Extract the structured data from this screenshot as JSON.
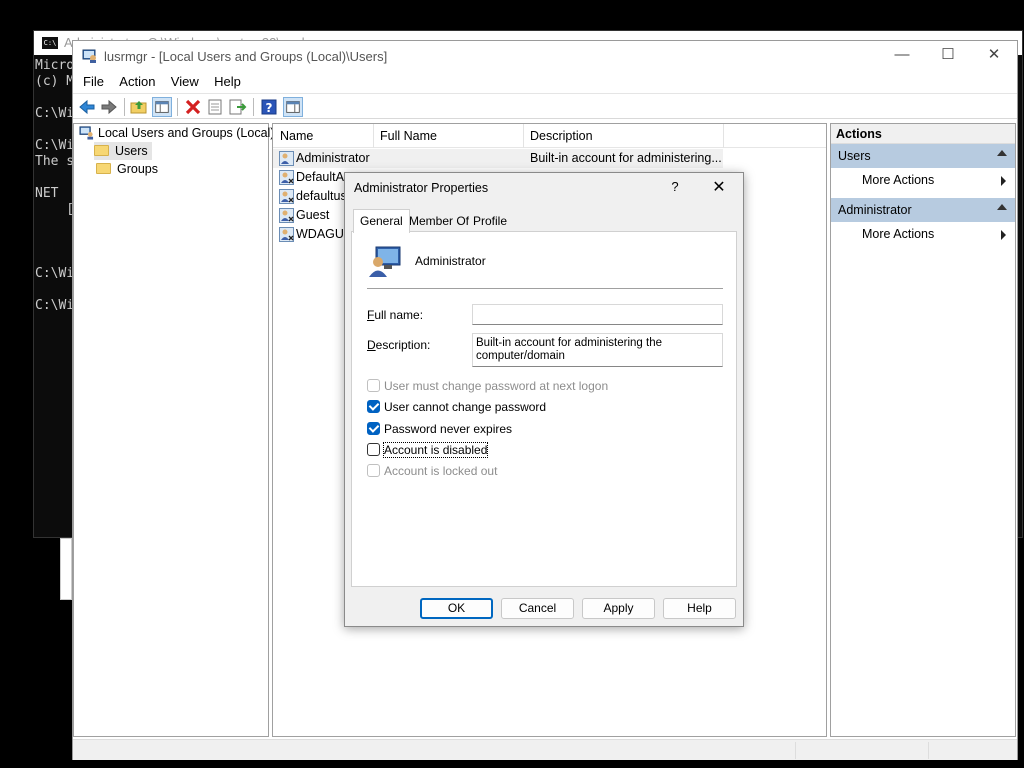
{
  "console": {
    "title": "Administrator: C:\\Windows\\system32\\cmd.exe",
    "lines": [
      "Micro",
      "(c) M",
      "",
      "C:\\Wi",
      "",
      "C:\\Wi",
      "The s",
      "",
      "NET",
      "    [",
      "",
      "",
      "",
      "C:\\Wi",
      "",
      "C:\\Wi"
    ]
  },
  "window": {
    "title": "lusrmgr - [Local Users and Groups (Local)\\Users]",
    "minimize": "—",
    "maximize": "☐",
    "close": "✕"
  },
  "menu": [
    "File",
    "Action",
    "View",
    "Help"
  ],
  "toolbar": {
    "icons": [
      "back-arrow-icon",
      "forward-arrow-icon",
      "up-folder-icon",
      "show-hide-tree-icon",
      "delete-icon",
      "properties-icon",
      "export-list-icon",
      "help-icon",
      "show-hide-action-pane-icon"
    ]
  },
  "tree": {
    "root": "Local Users and Groups (Local)",
    "items": [
      "Users",
      "Groups"
    ]
  },
  "list": {
    "columns": [
      "Name",
      "Full Name",
      "Description"
    ],
    "rows": [
      {
        "name": "Administrator",
        "full_name": "",
        "description": "Built-in account for administering..."
      },
      {
        "name": "DefaultAc",
        "full_name": "",
        "description": ""
      },
      {
        "name": "defaultus",
        "full_name": "",
        "description": ""
      },
      {
        "name": "Guest",
        "full_name": "",
        "description": ""
      },
      {
        "name": "WDAGUti",
        "full_name": "",
        "description": ""
      }
    ]
  },
  "actions": {
    "header": "Actions",
    "sections": [
      {
        "title": "Users",
        "item": "More Actions"
      },
      {
        "title": "Administrator",
        "item": "More Actions"
      }
    ]
  },
  "dialog": {
    "title": "Administrator Properties",
    "help_glyph": "?",
    "close_glyph": "✕",
    "tabs": [
      "General",
      "Member Of",
      "Profile"
    ],
    "active_tab": "General",
    "username": "Administrator",
    "full_name_label": "Full name:",
    "full_name_value": "",
    "description_label": "Description:",
    "description_value": "Built-in account for administering the computer/domain",
    "checkboxes": [
      {
        "label": "User must change password at next logon",
        "checked": false,
        "enabled": false
      },
      {
        "label": "User cannot change password",
        "checked": true,
        "enabled": true
      },
      {
        "label": "Password never expires",
        "checked": true,
        "enabled": true
      },
      {
        "label": "Account is disabled",
        "checked": false,
        "enabled": true
      },
      {
        "label": "Account is locked out",
        "checked": false,
        "enabled": false
      }
    ],
    "buttons": {
      "ok": "OK",
      "cancel": "Cancel",
      "apply": "Apply",
      "help": "Help"
    }
  },
  "colors": {
    "accent": "#0062c2",
    "action_section_bg": "#b7cbe0",
    "console_bg": "#0c0c0c"
  }
}
